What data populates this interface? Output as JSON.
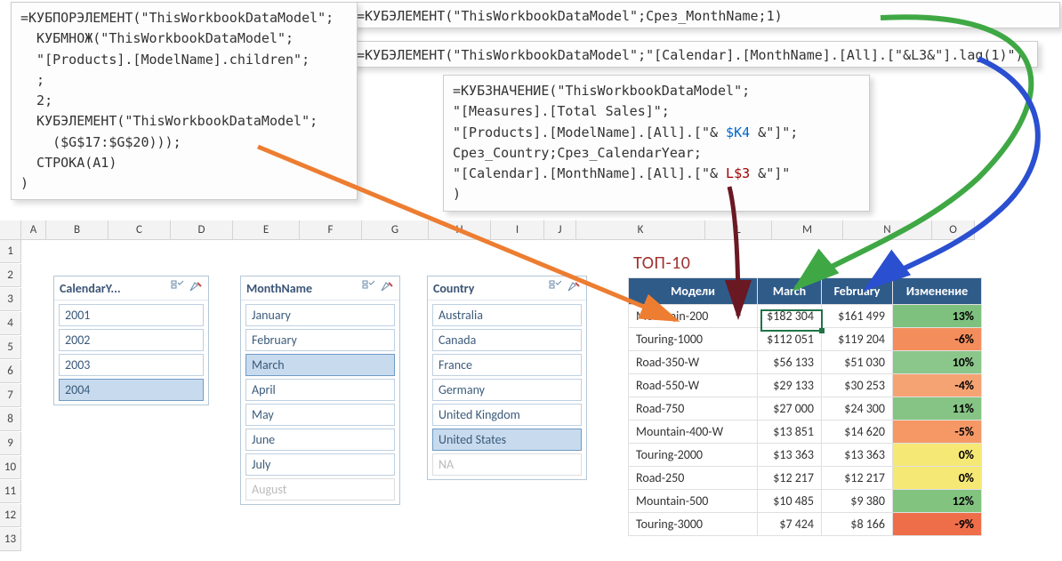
{
  "formulas": {
    "f1": "=КУБПОРЭЛЕМЕНТ(\"ThisWorkbookDataModel\";\n  КУБМНОЖ(\"ThisWorkbookDataModel\";\n  \"[Products].[ModelName].children\";\n  ;\n  2;\n  КУБЭЛЕМЕНТ(\"ThisWorkbookDataModel\";\n    ($G$17:$G$20)));\n  СТРОКА(A1)\n)",
    "f2": "=КУБЭЛЕМЕНТ(\"ThisWorkbookDataModel\";Срез_MonthName;1)",
    "f3": "=КУБЭЛЕМЕНТ(\"ThisWorkbookDataModel\";\"[Calendar].[MonthName].[All].[\"&L3&\"].lag(1)\")",
    "f4_lines": [
      "=КУБЗНАЧЕНИЕ(\"ThisWorkbookDataModel\";",
      "  \"[Measures].[Total Sales]\";",
      "  \"[Products].[ModelName].[All].[\"&",
      "  $K4",
      "  &\"]\";",
      "  Срез_Country;Срез_CalendarYear;",
      "  \"[Calendar].[MonthName].[All].[\"&",
      "  L$3",
      "  &\"]\""
    ]
  },
  "top10_label": "ТОП-10",
  "slicers": {
    "year": {
      "title": "CalendarY...",
      "items": [
        "2001",
        "2002",
        "2003",
        "2004"
      ],
      "selected": [
        3
      ]
    },
    "month": {
      "title": "MonthName",
      "items": [
        "January",
        "February",
        "March",
        "April",
        "May",
        "June",
        "July",
        "August"
      ],
      "selected": [
        2
      ],
      "disabled": [
        7
      ]
    },
    "country": {
      "title": "Country",
      "items": [
        "Australia",
        "Canada",
        "France",
        "Germany",
        "United Kingdom",
        "United States",
        "NA"
      ],
      "selected": [
        5
      ],
      "disabled": [
        6
      ]
    }
  },
  "table": {
    "headers": [
      "Модели",
      "March",
      "February",
      "Изменение"
    ],
    "rows": [
      {
        "m": "Mountain-200",
        "a": "$182 304",
        "b": "$161 499",
        "c": "13%",
        "color": "#7ec17e"
      },
      {
        "m": "Touring-1000",
        "a": "$112 051",
        "b": "$119 204",
        "c": "-6%",
        "color": "#f48d5c"
      },
      {
        "m": "Road-350-W",
        "a": "$56 133",
        "b": "$51 030",
        "c": "10%",
        "color": "#8bc68a"
      },
      {
        "m": "Road-550-W",
        "a": "$29 133",
        "b": "$30 253",
        "c": "-4%",
        "color": "#f6a373"
      },
      {
        "m": "Road-750",
        "a": "$27 000",
        "b": "$24 300",
        "c": "11%",
        "color": "#85c484"
      },
      {
        "m": "Mountain-400-W",
        "a": "$13 851",
        "b": "$14 620",
        "c": "-5%",
        "color": "#f59866"
      },
      {
        "m": "Touring-2000",
        "a": "$13 363",
        "b": "$13 363",
        "c": "0%",
        "color": "#f6e874"
      },
      {
        "m": "Road-250",
        "a": "$12 217",
        "b": "$12 217",
        "c": "0%",
        "color": "#f6e874"
      },
      {
        "m": "Mountain-500",
        "a": "$10 485",
        "b": "$9 380",
        "c": "12%",
        "color": "#82c380"
      },
      {
        "m": "Touring-3000",
        "a": "$7 424",
        "b": "$8 166",
        "c": "-9%",
        "color": "#ef6e4a"
      }
    ]
  },
  "grid": {
    "cols": [
      "A",
      "B",
      "C",
      "D",
      "E",
      "F",
      "G",
      "H",
      "I",
      "J",
      "K",
      "L",
      "M",
      "N",
      "O"
    ],
    "rows": [
      "1",
      "2",
      "3",
      "4",
      "5",
      "6",
      "7",
      "8",
      "9",
      "10",
      "11",
      "12",
      "13"
    ]
  },
  "colors": {
    "arrow_orange": "#ed7d31",
    "arrow_green": "#3fa845",
    "arrow_blue": "#2a4fd0",
    "arrow_dark": "#6a1822"
  }
}
